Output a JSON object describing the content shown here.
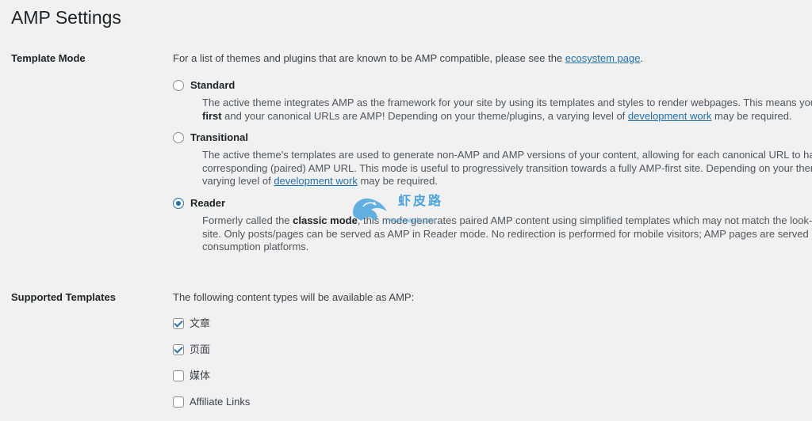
{
  "page": {
    "title": "AMP Settings"
  },
  "template_mode": {
    "label": "Template Mode",
    "intro_text": "For a list of themes and plugins that are known to be AMP compatible, please see the",
    "intro_link": "ecosystem page",
    "intro_end": ".",
    "options": [
      {
        "label": "Standard",
        "checked": false,
        "desc_a": "The active theme integrates AMP as the framework for your site by using its templates and styles to render webpages. This means you",
        "desc_bold": "first",
        "desc_b": " and your canonical URLs are AMP! Depending on your theme/plugins, a varying level of ",
        "desc_link": "development work",
        "desc_c": " may be required."
      },
      {
        "label": "Transitional",
        "checked": false,
        "desc_a": "The active theme's templates are used to generate non-AMP and AMP versions of your content, allowing for each canonical URL to hav",
        "desc_b": "corresponding (paired) AMP URL. This mode is useful to progressively transition towards a fully AMP-first site. Depending on your ther",
        "desc_c": "varying level of ",
        "desc_link": "development work",
        "desc_d": " may be required."
      },
      {
        "label": "Reader",
        "checked": true,
        "desc_a": "Formerly called the ",
        "desc_bold": "classic mode",
        "desc_b": ", this mode generates paired AMP content using simplified templates which may not match the look-a",
        "desc_c": "site. Only posts/pages can be served as AMP in Reader mode. No redirection is performed for mobile visitors; AMP pages are served b",
        "desc_d": "consumption platforms."
      }
    ]
  },
  "supported_templates": {
    "label": "Supported Templates",
    "intro_text": "The following content types will be available as AMP:",
    "items": [
      {
        "label": "文章",
        "checked": true
      },
      {
        "label": "页面",
        "checked": true
      },
      {
        "label": "媒体",
        "checked": false
      },
      {
        "label": "Affiliate Links",
        "checked": false
      }
    ]
  },
  "watermark": {
    "text": "虾皮路",
    "url": "www.xiapilu.com",
    "color": "#4aa3df"
  },
  "colors": {
    "accent": "#2271b1",
    "background": "#f1f1f1",
    "text": "#3c434a"
  }
}
